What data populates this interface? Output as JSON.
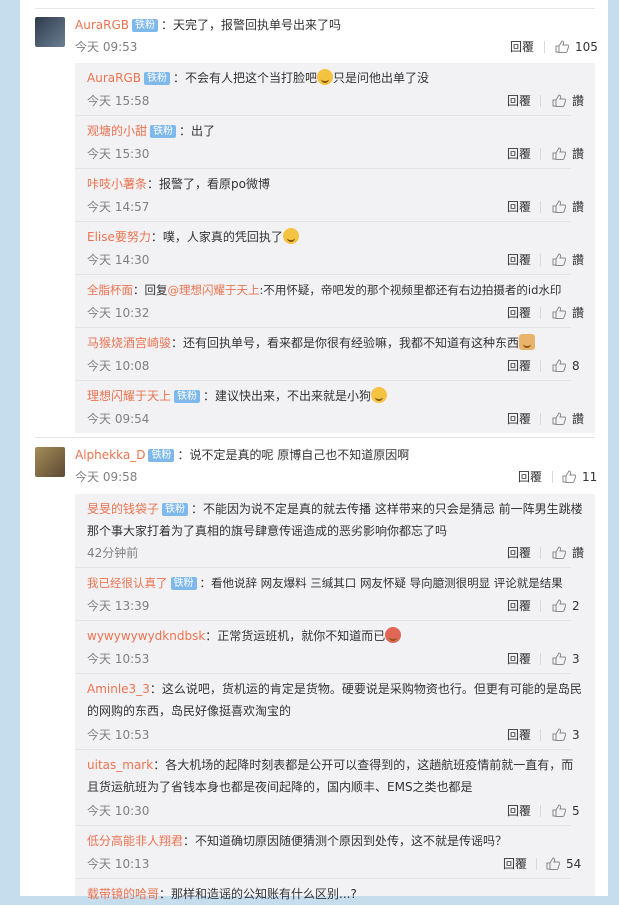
{
  "thread1": {
    "main": {
      "username": "AuraRGB",
      "badge": "铁粉",
      "text": "：天完了，报警回执单号出来了吗",
      "time": "今天 09:53",
      "reply": "回覆",
      "likes": "105"
    },
    "replies": [
      {
        "username": "AuraRGB",
        "badge": "铁粉",
        "text": "：不会有人把这个当打脸吧",
        "text2": "只是问他出单了没",
        "emoji": "laugh",
        "time": "今天 15:58",
        "reply": "回覆",
        "likes": "讚"
      },
      {
        "username": "观塘的小甜",
        "badge": "铁粉",
        "text": "：出了",
        "time": "今天 15:30",
        "reply": "回覆",
        "likes": "讚"
      },
      {
        "username": "咔吱小薯条",
        "text": "：报警了，看原po微博",
        "time": "今天 14:57",
        "reply": "回覆",
        "likes": "讚"
      },
      {
        "username": "Elise要努力",
        "text": "：噗，人家真的凭回执了",
        "emoji": "smile",
        "time": "今天 14:30",
        "reply": "回覆",
        "likes": "讚"
      },
      {
        "username": "全脂杯面",
        "text": "：回复",
        "mention": "@理想闪耀于天上",
        "text2": ":不用怀疑，帝吧发的那个视频里都还有右边拍摄者的id水印",
        "time": "今天 10:32",
        "reply": "回覆",
        "likes": "讚"
      },
      {
        "username": "马猴烧酒宫崎骏",
        "text": "：还有回执单号，看来都是你很有经验嘛，我都不知道有这种东西",
        "emoji": "cat",
        "time": "今天 10:08",
        "reply": "回覆",
        "likes": "8"
      },
      {
        "username": "理想闪耀于天上",
        "badge": "铁粉",
        "text": "：建议快出来，不出来就是小狗",
        "emoji": "smile",
        "time": "今天 09:54",
        "reply": "回覆",
        "likes": "讚"
      }
    ]
  },
  "thread2": {
    "main": {
      "username": "Alphekka_D",
      "badge": "铁粉",
      "text": "：说不定是真的呢 原博自己也不知道原因啊",
      "time": "今天 09:58",
      "reply": "回覆",
      "likes": "11"
    },
    "replies": [
      {
        "username": "旻旻的钱袋子",
        "badge": "铁粉",
        "text": "：不能因为说不定是真的就去传播 这样带来的只会是猜忌 前一阵男生跳楼那个事大家打着为了真相的旗号肆意传谣造成的恶劣影响你都忘了吗",
        "time": "42分钟前",
        "reply": "回覆",
        "likes": "讚"
      },
      {
        "username": "我已经很认真了",
        "badge": "铁粉",
        "text": "：看他说辞 网友爆料 三缄其口 网友怀疑 导向臆测很明显 评论就是结果",
        "time": "今天 13:39",
        "reply": "回覆",
        "likes": "2"
      },
      {
        "username": "wywywywydkndbsk",
        "text": "：正常货运班机，就你不知道而已",
        "emoji": "red",
        "time": "今天 10:53",
        "reply": "回覆",
        "likes": "3"
      },
      {
        "username": "Aminle3_3",
        "text": "：这么说吧，货机运的肯定是货物。硬要说是采购物资也行。但更有可能的是岛民的网购的东西，岛民好像挺喜欢淘宝的",
        "time": "今天 10:53",
        "reply": "回覆",
        "likes": "3"
      },
      {
        "username": "uitas_mark",
        "text": "：各大机场的起降时刻表都是公开可以查得到的，这趟航班疫情前就一直有，而且货运航班为了省钱本身也都是夜间起降的，国内顺丰、EMS之类也都是",
        "time": "今天 10:30",
        "reply": "回覆",
        "likes": "5"
      },
      {
        "username": "低分高能非人翔君",
        "text": "：不知道确切原因随便猜测个原因到处传，这不就是传谣吗？",
        "time": "今天 10:13",
        "reply": "回覆",
        "likes": "54"
      },
      {
        "username": "载带镜的哈哥",
        "text": "：那样和造谣的公知账有什么区别...?",
        "time": "",
        "reply": "",
        "likes": ""
      }
    ]
  },
  "colors": {
    "username": "#eb7350",
    "badge": "#7fb9ec",
    "background": "#c6ddee"
  }
}
